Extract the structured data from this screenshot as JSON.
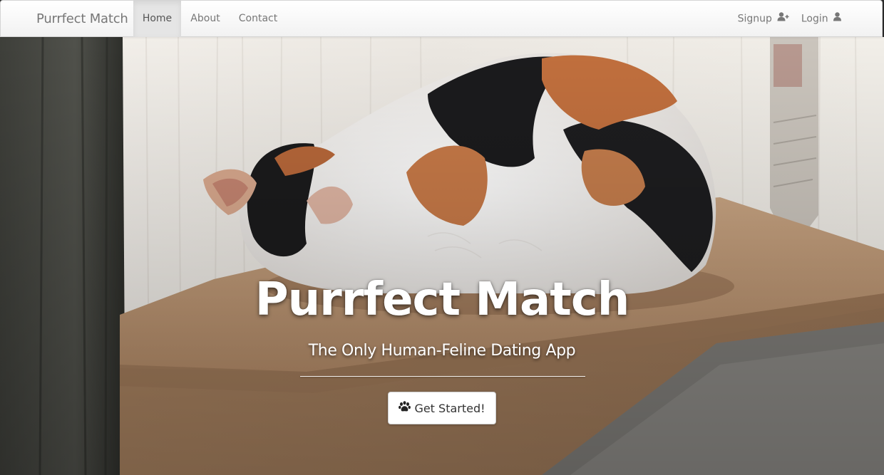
{
  "navbar": {
    "brand": "Purrfect Match",
    "links": [
      {
        "label": "Home",
        "active": true
      },
      {
        "label": "About",
        "active": false
      },
      {
        "label": "Contact",
        "active": false
      }
    ],
    "right": [
      {
        "label": "Signup",
        "icon": "user-plus-icon"
      },
      {
        "label": "Login",
        "icon": "user-icon"
      }
    ]
  },
  "hero": {
    "background_image": "calico-cat-sleeping-on-cushion",
    "title": "Purrfect Match",
    "subtitle": "The Only Human-Feline Dating App",
    "cta": {
      "label": "Get Started!",
      "icon": "paw-icon"
    }
  },
  "colors": {
    "navbar_bg": "#f8f8f8",
    "nav_text": "#777777",
    "active_bg": "#e7e7e7",
    "hero_text": "#ffffff"
  }
}
